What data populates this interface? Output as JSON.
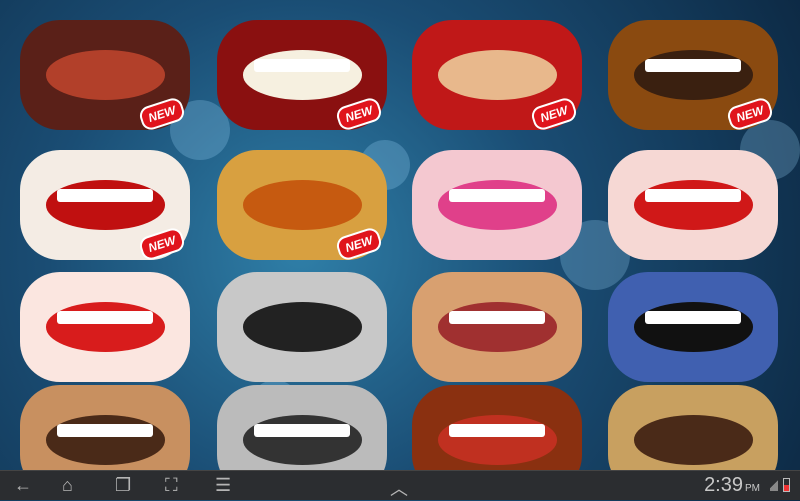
{
  "items": [
    {
      "name": "red-lips",
      "bg": "#5a2018",
      "mouth": "#b2402a",
      "teeth": false,
      "new": true
    },
    {
      "name": "big-teeth",
      "bg": "#8a1010",
      "mouth": "#f6f0e0",
      "teeth": true,
      "new": true
    },
    {
      "name": "mustache",
      "bg": "#c01818",
      "mouth": "#e8b88c",
      "teeth": false,
      "new": true
    },
    {
      "name": "tiger-fangs",
      "bg": "#8a4a10",
      "mouth": "#3a2010",
      "teeth": true,
      "new": true
    },
    {
      "name": "cartoon-cloud-mouth",
      "bg": "#f4ece4",
      "mouth": "#c01010",
      "teeth": true,
      "new": true
    },
    {
      "name": "bird-beak",
      "bg": "#d8a040",
      "mouth": "#c65a10",
      "teeth": false,
      "new": true
    },
    {
      "name": "pink-lips",
      "bg": "#f4c8d0",
      "mouth": "#e0408a",
      "teeth": true,
      "new": false
    },
    {
      "name": "glossy-red-lips",
      "bg": "#f6d8d4",
      "mouth": "#d01818",
      "teeth": true,
      "new": false
    },
    {
      "name": "cartoon-red-lips",
      "bg": "#fbe6e0",
      "mouth": "#d81c1c",
      "teeth": true,
      "new": false
    },
    {
      "name": "dog-nose",
      "bg": "#c8c8c8",
      "mouth": "#222",
      "teeth": false,
      "new": false
    },
    {
      "name": "smiling-man",
      "bg": "#d8a070",
      "mouth": "#a03030",
      "teeth": true,
      "new": false
    },
    {
      "name": "blue-monster",
      "bg": "#4060b0",
      "mouth": "#111",
      "teeth": true,
      "new": false
    },
    {
      "name": "mouth-13",
      "bg": "#c89060",
      "mouth": "#4a2a18",
      "teeth": true,
      "new": false
    },
    {
      "name": "mouth-14",
      "bg": "#bbbbbb",
      "mouth": "#333",
      "teeth": true,
      "new": false
    },
    {
      "name": "mouth-15",
      "bg": "#8a3010",
      "mouth": "#c03020",
      "teeth": true,
      "new": false
    },
    {
      "name": "mouth-16",
      "bg": "#c8a060",
      "mouth": "#4a2a18",
      "teeth": false,
      "new": false
    }
  ],
  "badge_label": "NEW",
  "navbar": {
    "back": "←",
    "home": "⌂",
    "recent": "❐",
    "screenshot": "⛶",
    "menu": "☰",
    "up": "︿",
    "time": "2:39",
    "ampm": "PM"
  }
}
